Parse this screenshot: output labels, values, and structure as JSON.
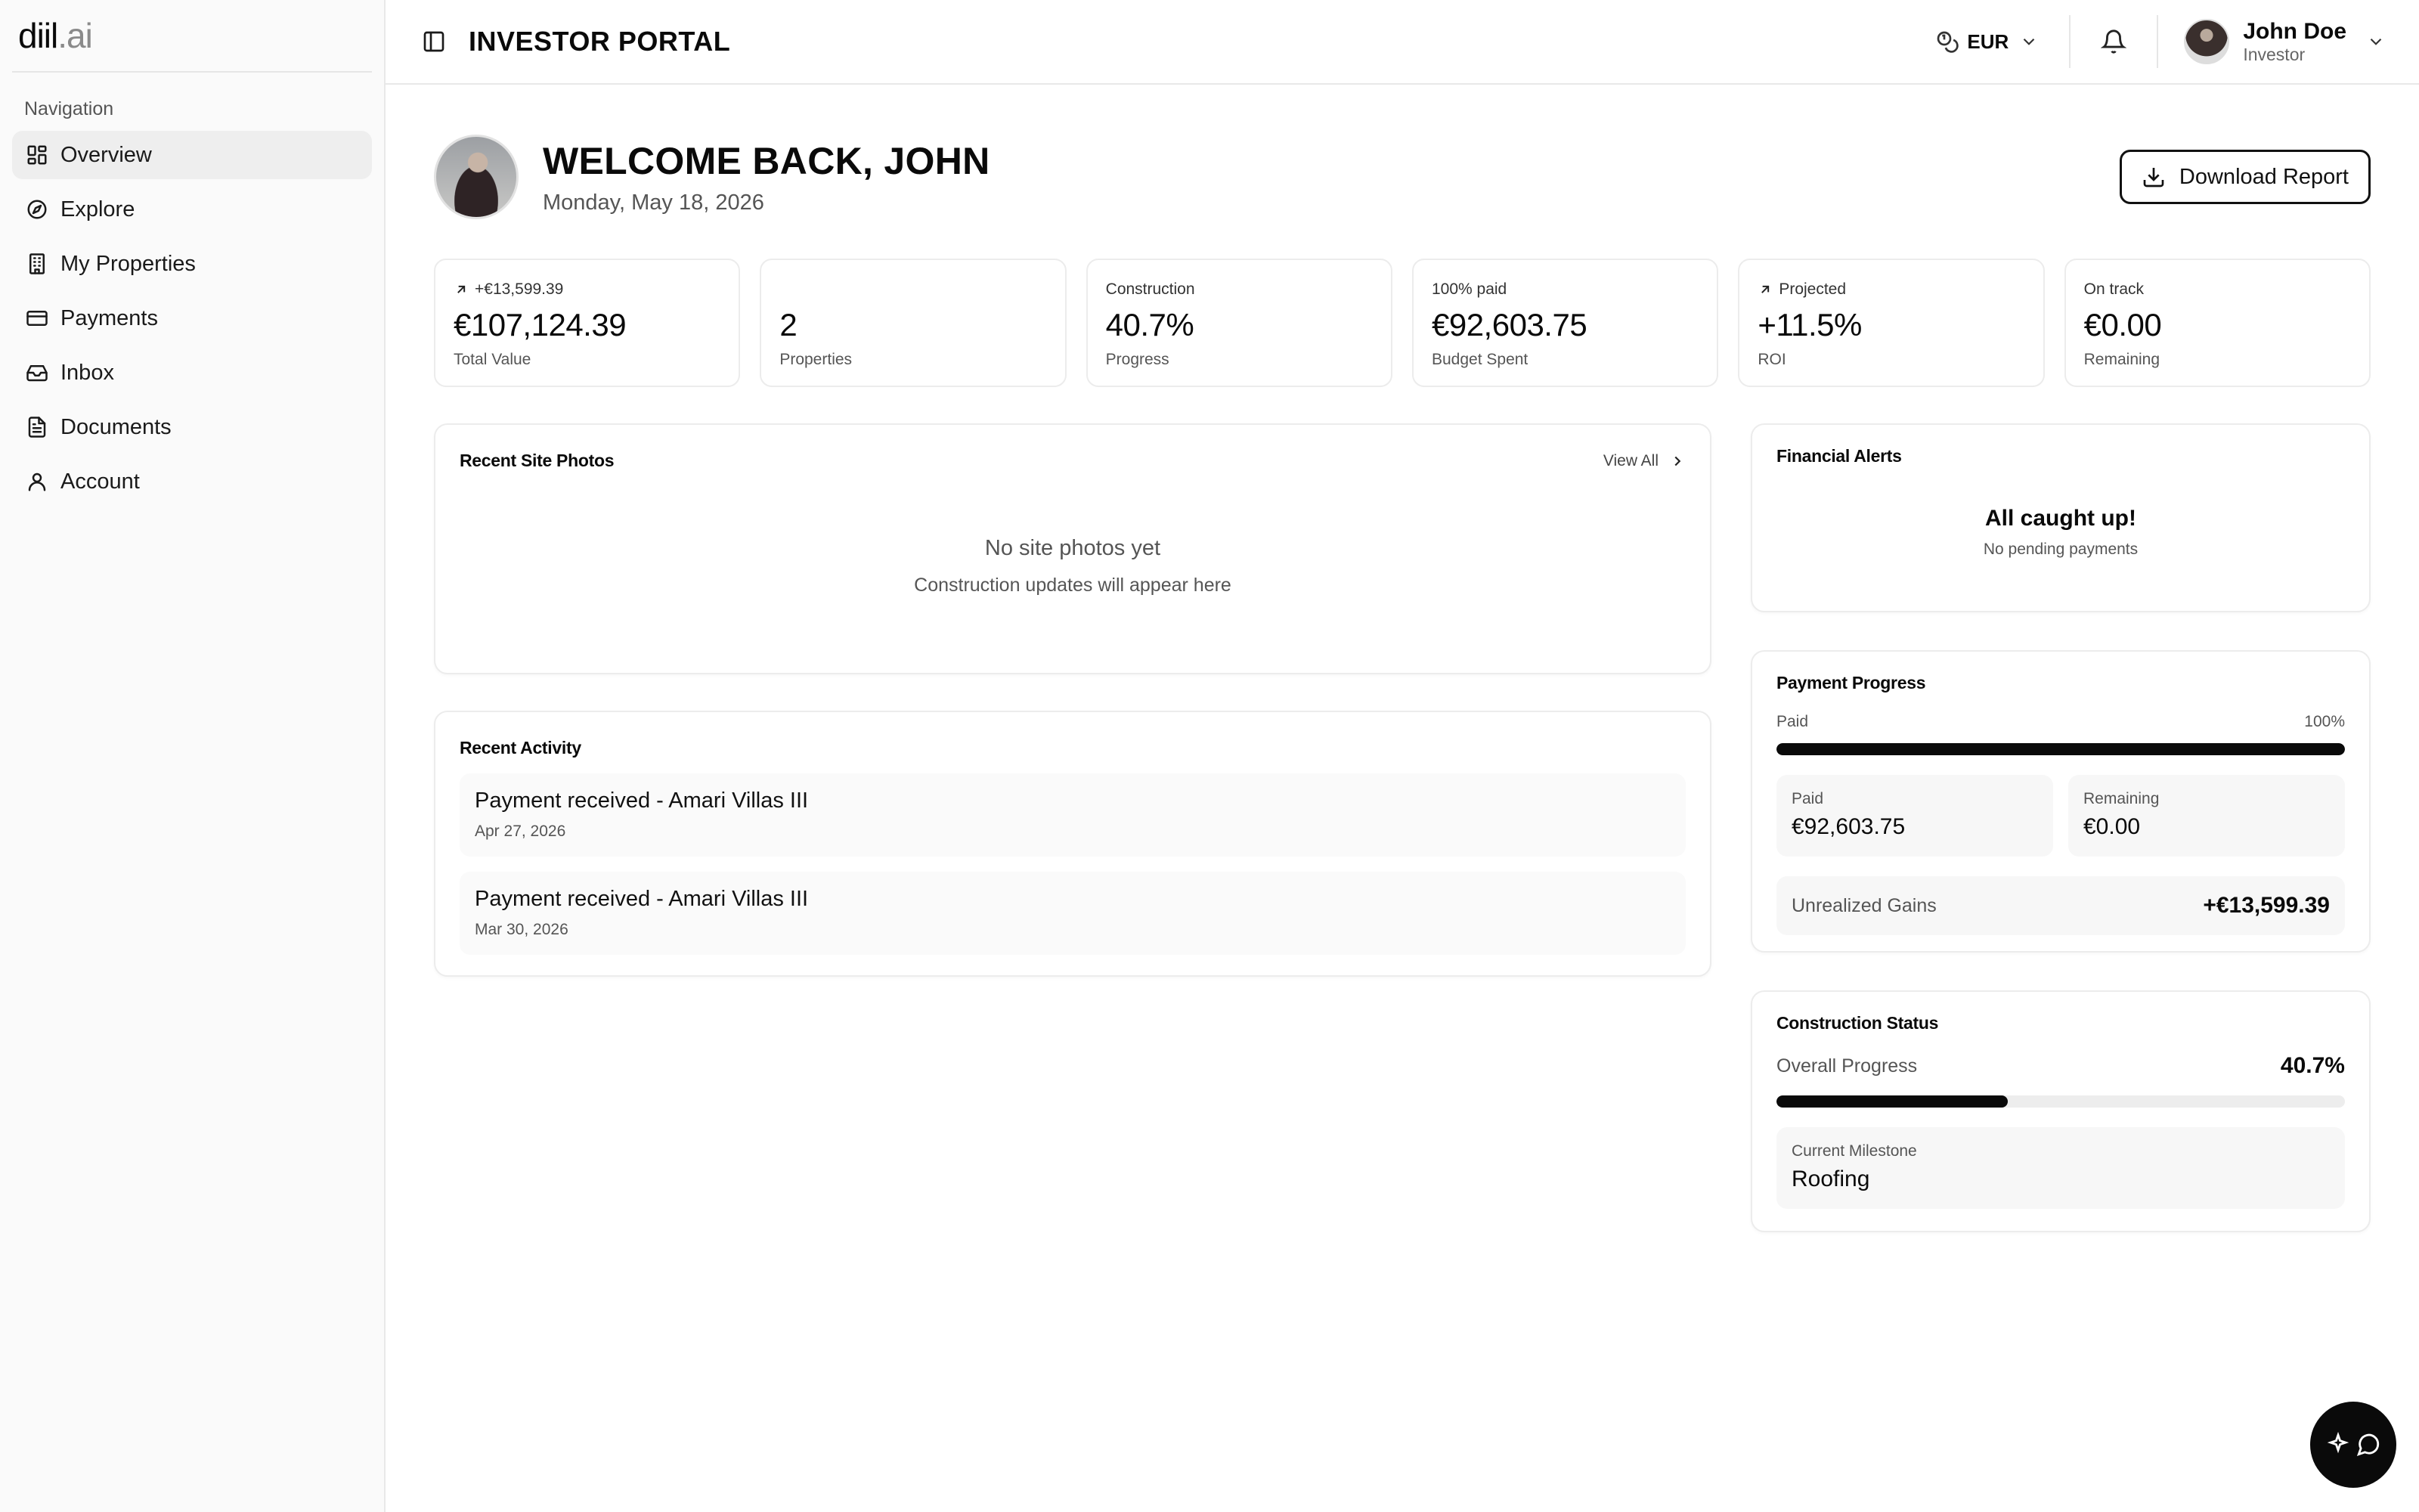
{
  "brand": {
    "name_main": "diil",
    "name_suffix": ".ai"
  },
  "sidebar": {
    "section_label": "Navigation",
    "items": [
      {
        "label": "Overview",
        "icon": "grid-icon",
        "active": true
      },
      {
        "label": "Explore",
        "icon": "compass-icon"
      },
      {
        "label": "My Properties",
        "icon": "building-icon"
      },
      {
        "label": "Payments",
        "icon": "credit-card-icon"
      },
      {
        "label": "Inbox",
        "icon": "inbox-icon"
      },
      {
        "label": "Documents",
        "icon": "document-icon"
      },
      {
        "label": "Account",
        "icon": "user-icon"
      }
    ]
  },
  "header": {
    "title": "INVESTOR PORTAL",
    "currency": "EUR",
    "user": {
      "name": "John Doe",
      "role": "Investor"
    }
  },
  "welcome": {
    "title": "WELCOME BACK, JOHN",
    "date": "Monday, May 18, 2026",
    "download_label": "Download Report"
  },
  "stats": [
    {
      "top": "+€13,599.39",
      "top_icon": "arrow-up-right-icon",
      "value": "€107,124.39",
      "label": "Total Value"
    },
    {
      "top": "",
      "value": "2",
      "label": "Properties"
    },
    {
      "top": "Construction",
      "value": "40.7%",
      "label": "Progress"
    },
    {
      "top": "100% paid",
      "value": "€92,603.75",
      "label": "Budget Spent"
    },
    {
      "top": "Projected",
      "top_icon": "arrow-up-right-icon",
      "value": "+11.5%",
      "label": "ROI"
    },
    {
      "top": "On track",
      "value": "€0.00",
      "label": "Remaining"
    }
  ],
  "photos": {
    "title": "Recent Site Photos",
    "view_all": "View All",
    "empty_title": "No site photos yet",
    "empty_sub": "Construction updates will appear here"
  },
  "activity": {
    "title": "Recent Activity",
    "items": [
      {
        "title": "Payment received - Amari Villas III",
        "date": "Apr 27, 2026"
      },
      {
        "title": "Payment received - Amari Villas III",
        "date": "Mar 30, 2026"
      }
    ]
  },
  "alerts": {
    "title": "Financial Alerts",
    "status": "All caught up!",
    "sub": "No pending payments"
  },
  "payment_progress": {
    "title": "Payment Progress",
    "bar_label": "Paid",
    "bar_percent_text": "100%",
    "percent": 100,
    "paid_label": "Paid",
    "paid_value": "€92,603.75",
    "remaining_label": "Remaining",
    "remaining_value": "€0.00",
    "gains_label": "Unrealized Gains",
    "gains_value": "+€13,599.39"
  },
  "construction": {
    "title": "Construction Status",
    "overall_label": "Overall Progress",
    "overall_value": "40.7%",
    "percent": 40.7,
    "milestone_label": "Current Milestone",
    "milestone_value": "Roofing"
  },
  "colors": {
    "accent": "#0a0a0a",
    "muted_bg": "#f7f7f7",
    "border": "#ececec"
  }
}
